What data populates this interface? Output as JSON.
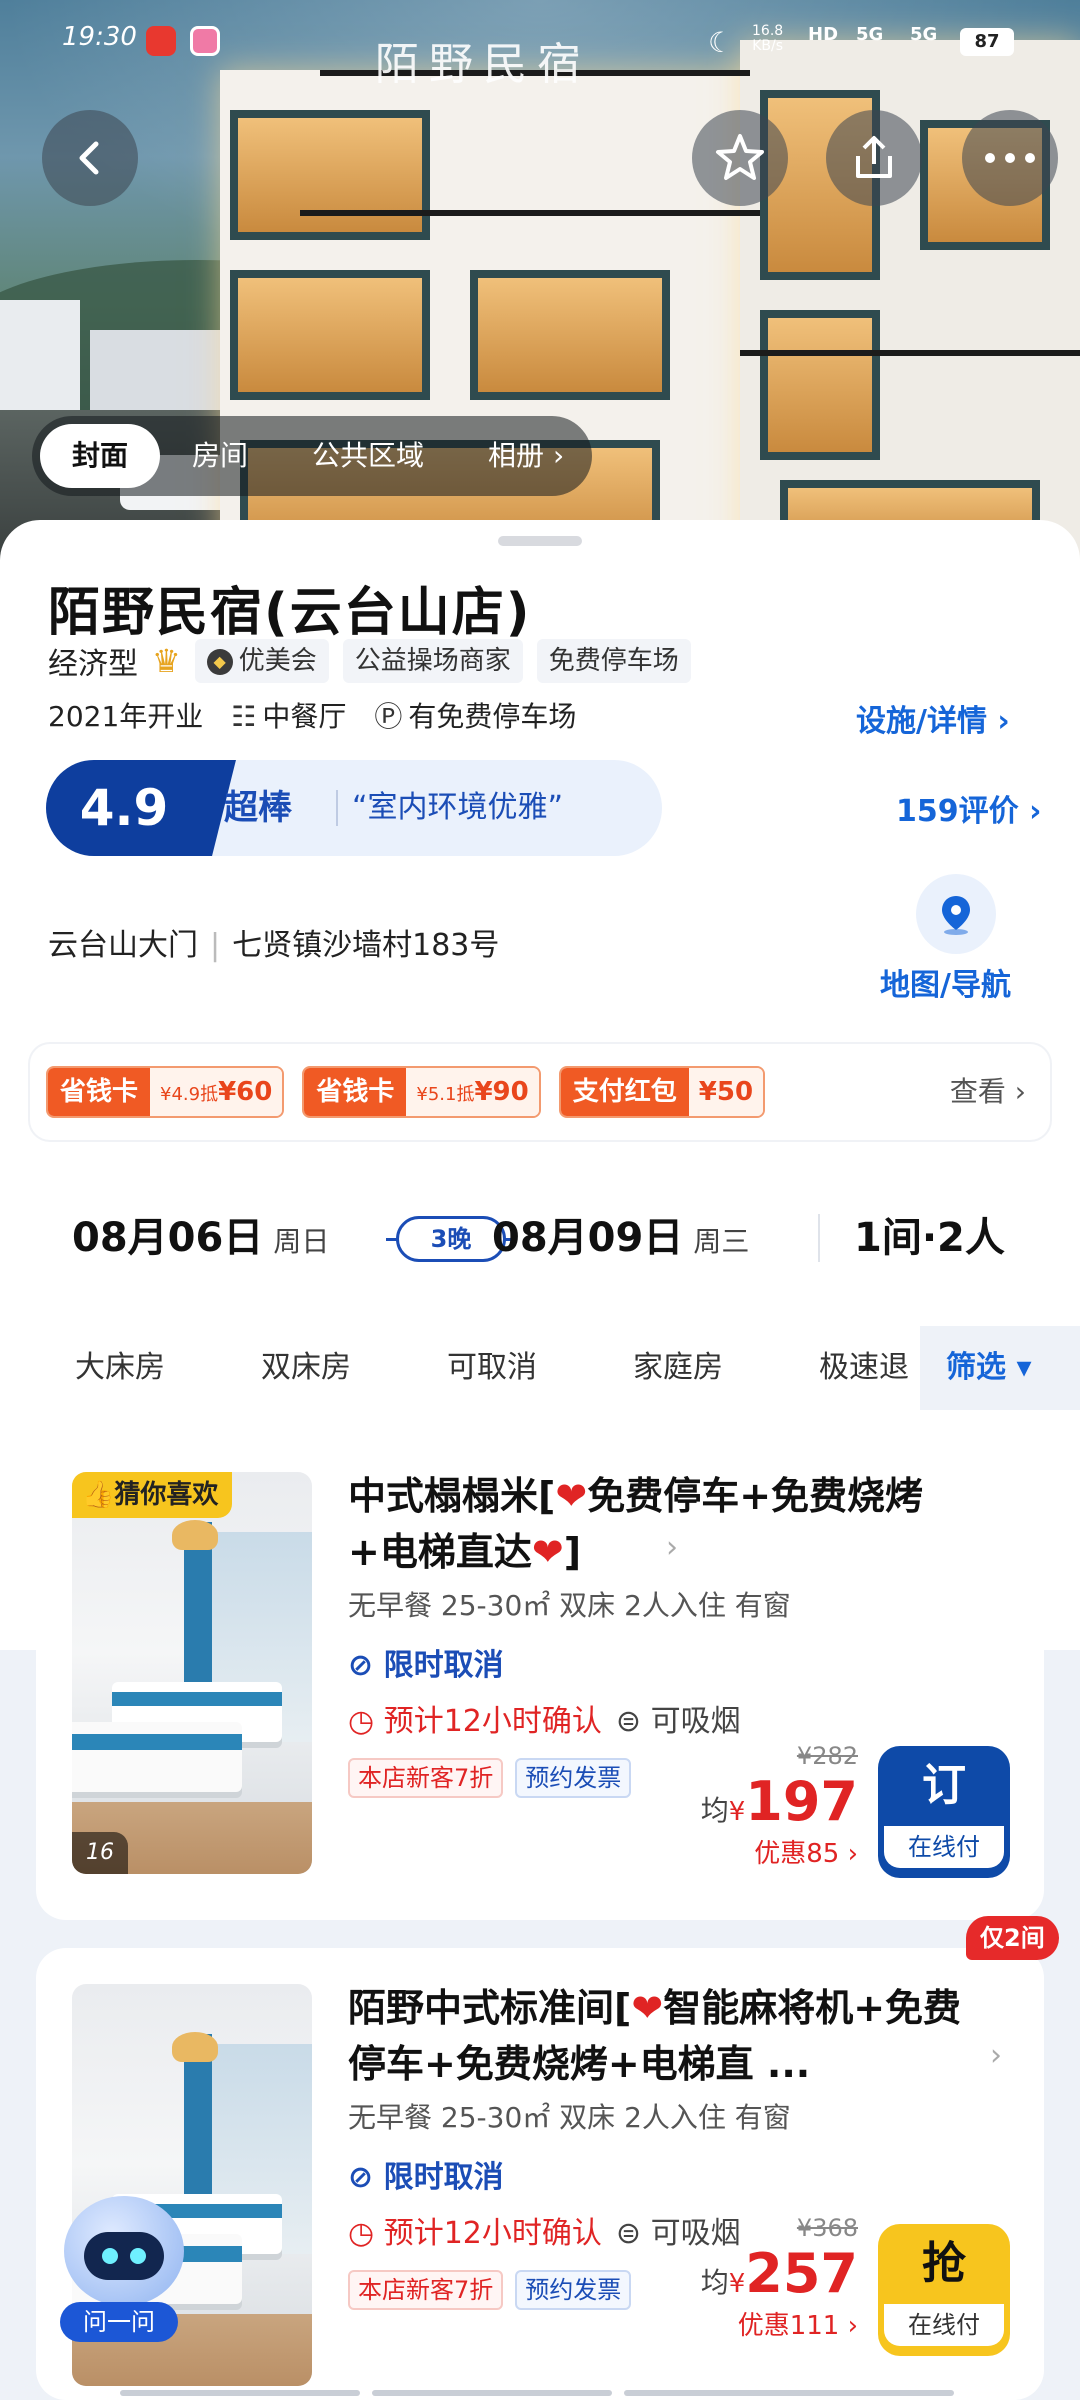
{
  "status_bar": {
    "time": "19:30",
    "network_speed": "16.8",
    "network_unit": "KB/s",
    "hd_label": "HD",
    "signal1": "5G",
    "signal2": "5G",
    "battery": "87"
  },
  "hero": {
    "sign_text": "陌野民宿",
    "tabs": [
      "封面",
      "房间",
      "公共区域",
      "相册 ›"
    ]
  },
  "hotel": {
    "name": "陌野民宿(云台山店)",
    "type": "经济型",
    "crown_icon": "crown-icon",
    "member_tag": "优美会",
    "tags": [
      "公益操场商家",
      "免费停车场"
    ],
    "opened": "2021年开业",
    "restaurant": "中餐厅",
    "parking": "有免费停车场",
    "facilities_link": "设施/详情 ›",
    "rating": {
      "score": "4.9",
      "level": "超棒",
      "quote": "“室内环境优雅”",
      "reviews_link": "159评价 ›"
    },
    "address_area": "云台山大门",
    "address_detail": "七贤镇沙墙村183号",
    "map_label": "地图/导航"
  },
  "promos": [
    {
      "label": "省钱卡",
      "small": "¥4.9抵",
      "value": "¥60"
    },
    {
      "label": "省钱卡",
      "small": "¥5.1抵",
      "value": "¥90"
    },
    {
      "label": "支付红包",
      "small": "",
      "value": "¥50"
    }
  ],
  "promo_more": "查看 ›",
  "dates": {
    "checkin": "08月06日",
    "checkin_weekday": "周日",
    "nights": "3晚",
    "checkout": "08月09日",
    "checkout_weekday": "周三",
    "rooms_guests": "1间·2人"
  },
  "filters": [
    "大床房",
    "双床房",
    "可取消",
    "家庭房",
    "极速退"
  ],
  "filter_button": "筛选 ▾",
  "rooms": [
    {
      "badge": "猜你喜欢",
      "photo_count": "16",
      "title_a": "中式榻榻米[",
      "title_b": "免费停车+免费烧烤+电梯直达",
      "title_c": "]",
      "specs": "无早餐 25-30㎡ 双床 2人入住 有窗",
      "cancel": "限时取消",
      "confirm": "预计12小时确认",
      "smoke": "可吸烟",
      "tags": [
        "本店新客7折",
        "预约发票"
      ],
      "old_price": "¥282",
      "price_prefix": "均",
      "price_symbol": "¥",
      "price": "197",
      "discount": "优惠85 ›",
      "book_main": "订",
      "book_sub": "在线付"
    },
    {
      "title_a": "陌野中式标准间[",
      "title_b": "智能麻将机+免费停车+免费烧烤+电梯直 ...",
      "specs": "无早餐 25-30㎡ 双床 2人入住 有窗",
      "cancel": "限时取消",
      "confirm": "预计12小时确认",
      "smoke": "可吸烟",
      "tags": [
        "本店新客7折",
        "预约发票"
      ],
      "old_price": "¥368",
      "price_prefix": "均",
      "price_symbol": "¥",
      "price": "257",
      "discount": "优惠111 ›",
      "book_main": "抢",
      "book_sub": "在线付",
      "only_left": "仅2间"
    }
  ],
  "assistant_label": "问一问",
  "colors": {
    "brand_blue": "#0e4aa8",
    "link_blue": "#1565d8",
    "price_red": "#e02424",
    "promo_orange": "#f05a24",
    "badge_yellow": "#f7c51e"
  }
}
